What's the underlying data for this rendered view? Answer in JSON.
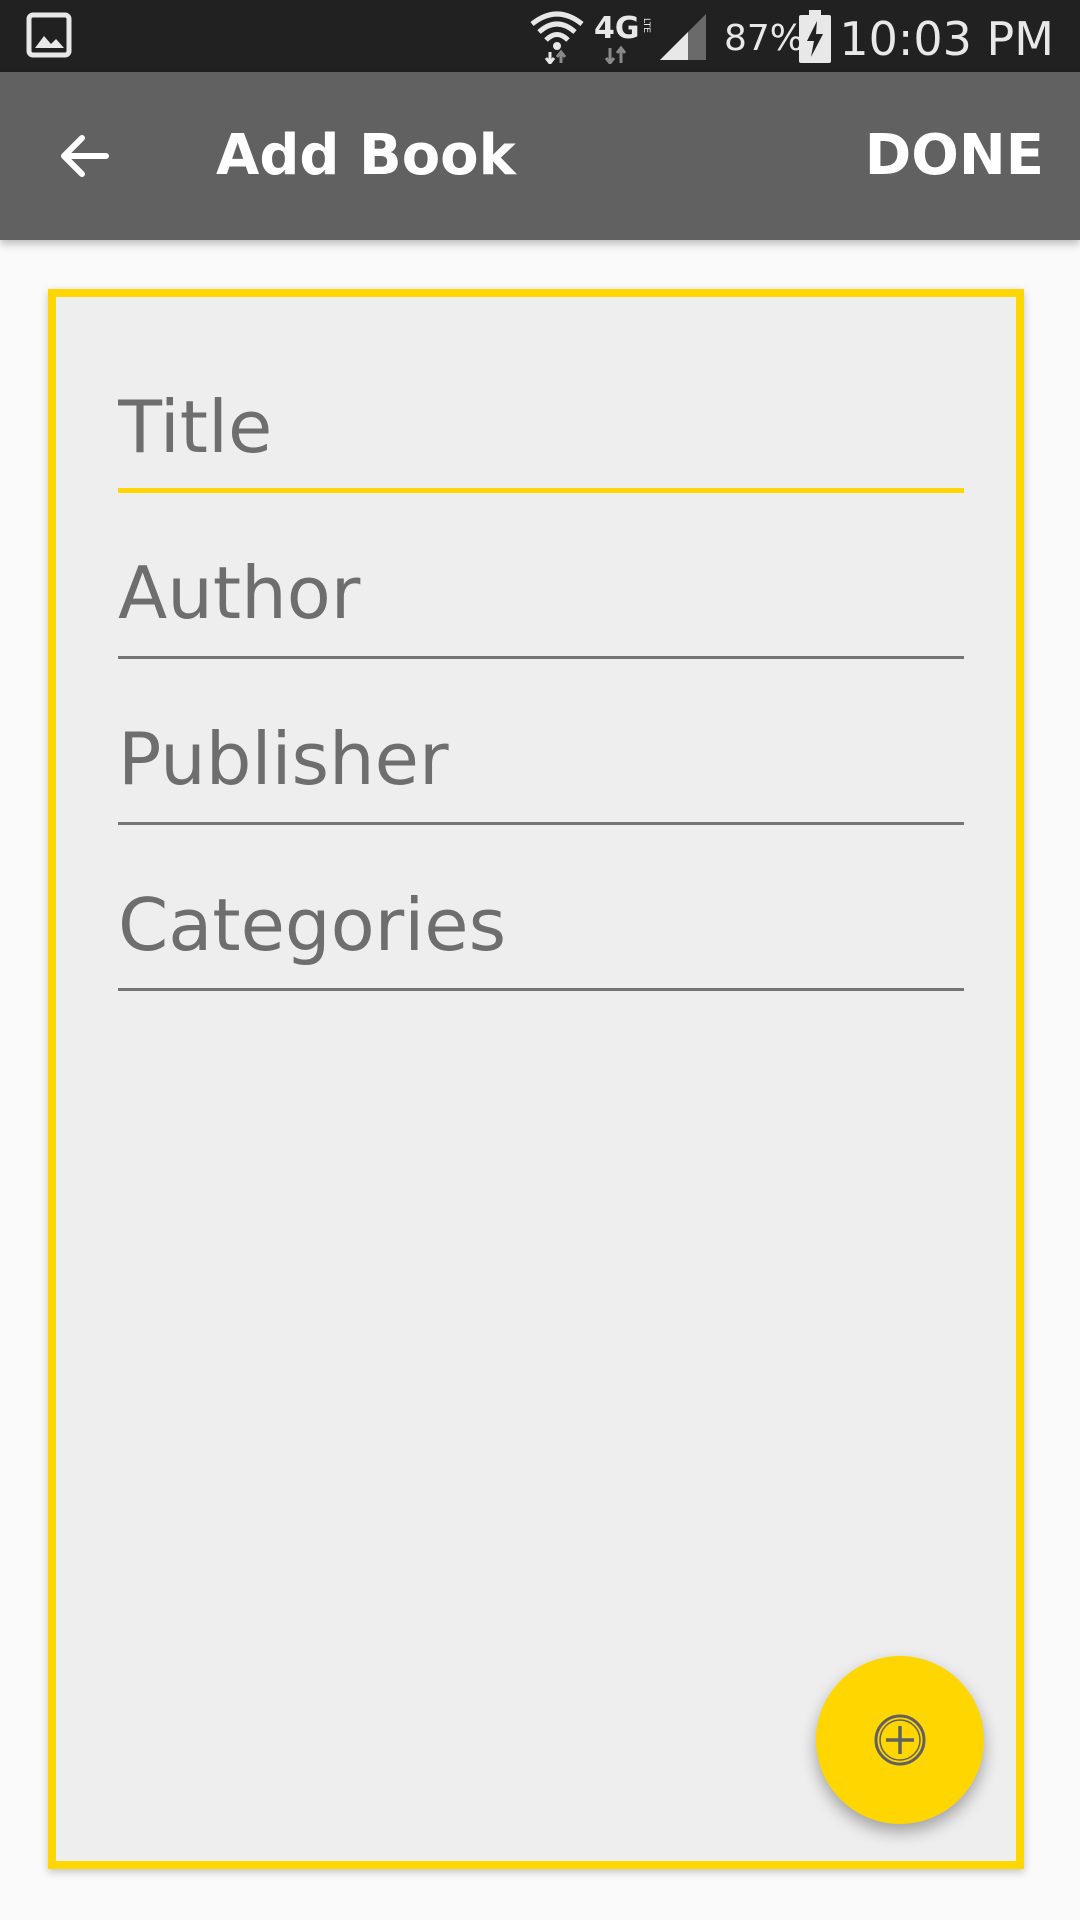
{
  "status_bar": {
    "battery_percent": "87%",
    "time": "10:03 PM",
    "network_label": "4G",
    "network_sublabel": "LTE",
    "icons": [
      "gallery-icon",
      "wifi-icon",
      "network-4g-lte-icon",
      "signal-icon",
      "battery-charging-icon"
    ]
  },
  "toolbar": {
    "back_icon": "arrow-back-icon",
    "title": "Add Book",
    "done_label": "DONE"
  },
  "form": {
    "fields": [
      {
        "placeholder": "Title",
        "value": "",
        "focused": true
      },
      {
        "placeholder": "Author",
        "value": ""
      },
      {
        "placeholder": "Publisher",
        "value": ""
      },
      {
        "placeholder": "Categories",
        "value": ""
      }
    ]
  },
  "fab": {
    "icon": "add-circle-icon"
  },
  "colors": {
    "accent": "#ffd600",
    "toolbar": "#616161",
    "status_bar": "#212121",
    "card_background": "#eeeeee",
    "page_background": "#fafafa",
    "field_text": "#6e6e6e"
  }
}
